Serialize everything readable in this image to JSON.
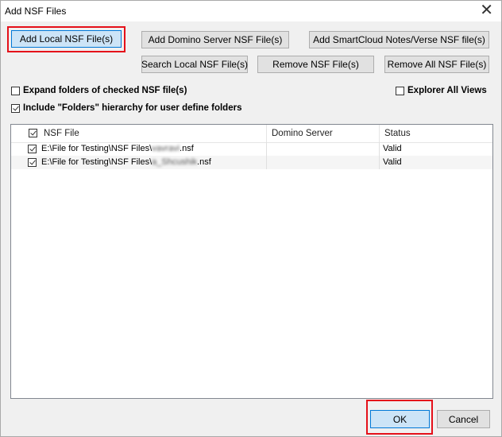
{
  "window": {
    "title": "Add NSF Files",
    "close_glyph": "✕"
  },
  "toolbar": {
    "add_local": "Add Local NSF File(s)",
    "add_domino": "Add Domino Server NSF File(s)",
    "add_smartcloud": "Add SmartCloud Notes/Verse NSF file(s)",
    "search_local": "Search Local NSF File(s)",
    "remove": "Remove NSF File(s)",
    "remove_all": "Remove All NSF File(s)"
  },
  "options": {
    "expand_folders": {
      "label": "Expand folders of checked NSF file(s)",
      "checked": false
    },
    "explorer_views": {
      "label": "Explorer All Views",
      "checked": false
    },
    "include_folders": {
      "label": "Include \"Folders\" hierarchy for user define folders",
      "checked": true
    }
  },
  "table": {
    "columns": [
      "NSF File",
      "Domino Server",
      "Status"
    ],
    "rows": [
      {
        "checked": true,
        "path": "E:\\File for Testing\\NSF Files\\",
        "name": "vavravi",
        "ext": ".nsf",
        "server": "",
        "status": "Valid"
      },
      {
        "checked": true,
        "path": "E:\\File for Testing\\NSF Files\\",
        "name": "a_Shcushik",
        "ext": ".nsf",
        "server": "",
        "status": "Valid"
      }
    ]
  },
  "footer": {
    "ok": "OK",
    "cancel": "Cancel"
  },
  "colors": {
    "highlight": "#e5101a",
    "active_button": "#cce4f7"
  }
}
